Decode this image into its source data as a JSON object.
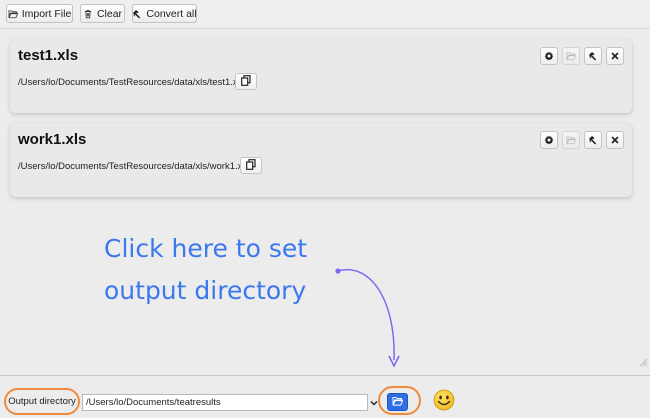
{
  "toolbar": {
    "import_label": "Import File",
    "clear_label": "Clear",
    "convert_label": "Convert all"
  },
  "files": [
    {
      "name": "test1.xls",
      "path": "/Users/lo/Documents/TestResources/data/xls/test1.xls"
    },
    {
      "name": "work1.xls",
      "path": "/Users/lo/Documents/TestResources/data/xls/work1.xls"
    }
  ],
  "annotation": {
    "line1": "Click here to set",
    "line2": "output directory"
  },
  "output": {
    "label": "Output directory",
    "path": "/Users/lo/Documents/teatresults"
  },
  "colors": {
    "accent_blue": "#2f6fe6",
    "highlight_orange": "#f08a3a",
    "annotation_blue": "#3b78f0",
    "arrow_purple": "#7b6cf0",
    "smiley_yellow": "#f6c624"
  },
  "icons": {
    "import": "folder-open-icon",
    "clear": "trash-icon",
    "convert": "hammer-icon",
    "copy": "copy-icon",
    "settings": "gear-icon",
    "open_folder": "folder-open-icon",
    "convert_file": "hammer-icon",
    "remove": "close-icon",
    "browse": "folder-open-icon",
    "status": "smiley-face-icon"
  }
}
